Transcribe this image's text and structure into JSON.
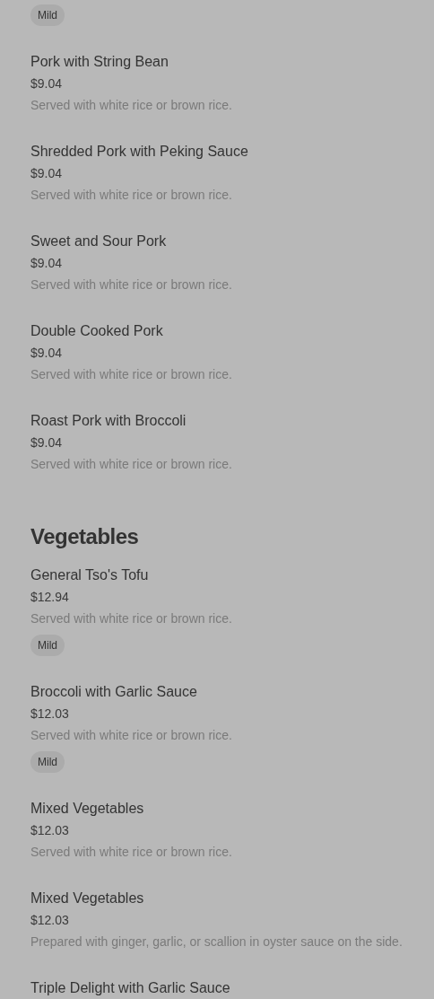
{
  "sections": [
    {
      "items": [
        {
          "tags": [
            "Mild"
          ]
        },
        {
          "name": "Pork with String Bean",
          "price": "$9.04",
          "description": "Served with white rice or brown rice."
        },
        {
          "name": "Shredded Pork with Peking Sauce",
          "price": "$9.04",
          "description": "Served with white rice or brown rice."
        },
        {
          "name": "Sweet and Sour Pork",
          "price": "$9.04",
          "description": "Served with white rice or brown rice."
        },
        {
          "name": "Double Cooked Pork",
          "price": "$9.04",
          "description": "Served with white rice or brown rice."
        },
        {
          "name": "Roast Pork with Broccoli",
          "price": "$9.04",
          "description": "Served with white rice or brown rice."
        }
      ]
    },
    {
      "title": "Vegetables",
      "items": [
        {
          "name": "General Tso's Tofu",
          "price": "$12.94",
          "description": "Served with white rice or brown rice.",
          "tags": [
            "Mild"
          ]
        },
        {
          "name": "Broccoli with Garlic Sauce",
          "price": "$12.03",
          "description": "Served with white rice or brown rice.",
          "tags": [
            "Mild"
          ]
        },
        {
          "name": "Mixed Vegetables",
          "price": "$12.03",
          "description": "Served with white rice or brown rice."
        },
        {
          "name": "Mixed Vegetables",
          "price": "$12.03",
          "description": "Prepared with ginger, garlic, or scallion in oyster sauce on the side."
        },
        {
          "name": "Triple Delight with Garlic Sauce"
        }
      ]
    }
  ]
}
